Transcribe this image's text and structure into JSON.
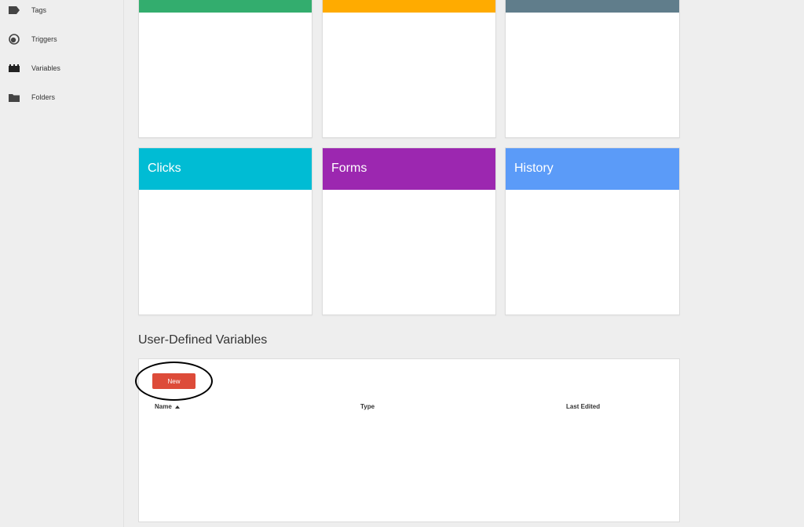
{
  "sidebar": {
    "items": [
      {
        "label": "Tags",
        "icon": "tag-icon"
      },
      {
        "label": "Triggers",
        "icon": "trigger-icon"
      },
      {
        "label": "Variables",
        "icon": "variables-icon"
      },
      {
        "label": "Folders",
        "icon": "folder-icon"
      }
    ]
  },
  "cards_top": [
    {
      "color": "#33ad6e"
    },
    {
      "color": "#ffab00"
    },
    {
      "color": "#607d8b"
    }
  ],
  "cards_mid": [
    {
      "title": "Clicks",
      "color": "#00bcd4"
    },
    {
      "title": "Forms",
      "color": "#9c27b0"
    },
    {
      "title": "History",
      "color": "#5b9bf8"
    }
  ],
  "user_defined": {
    "title": "User-Defined Variables",
    "new_label": "New",
    "columns": {
      "name": "Name",
      "type": "Type",
      "last_edited": "Last Edited"
    }
  }
}
